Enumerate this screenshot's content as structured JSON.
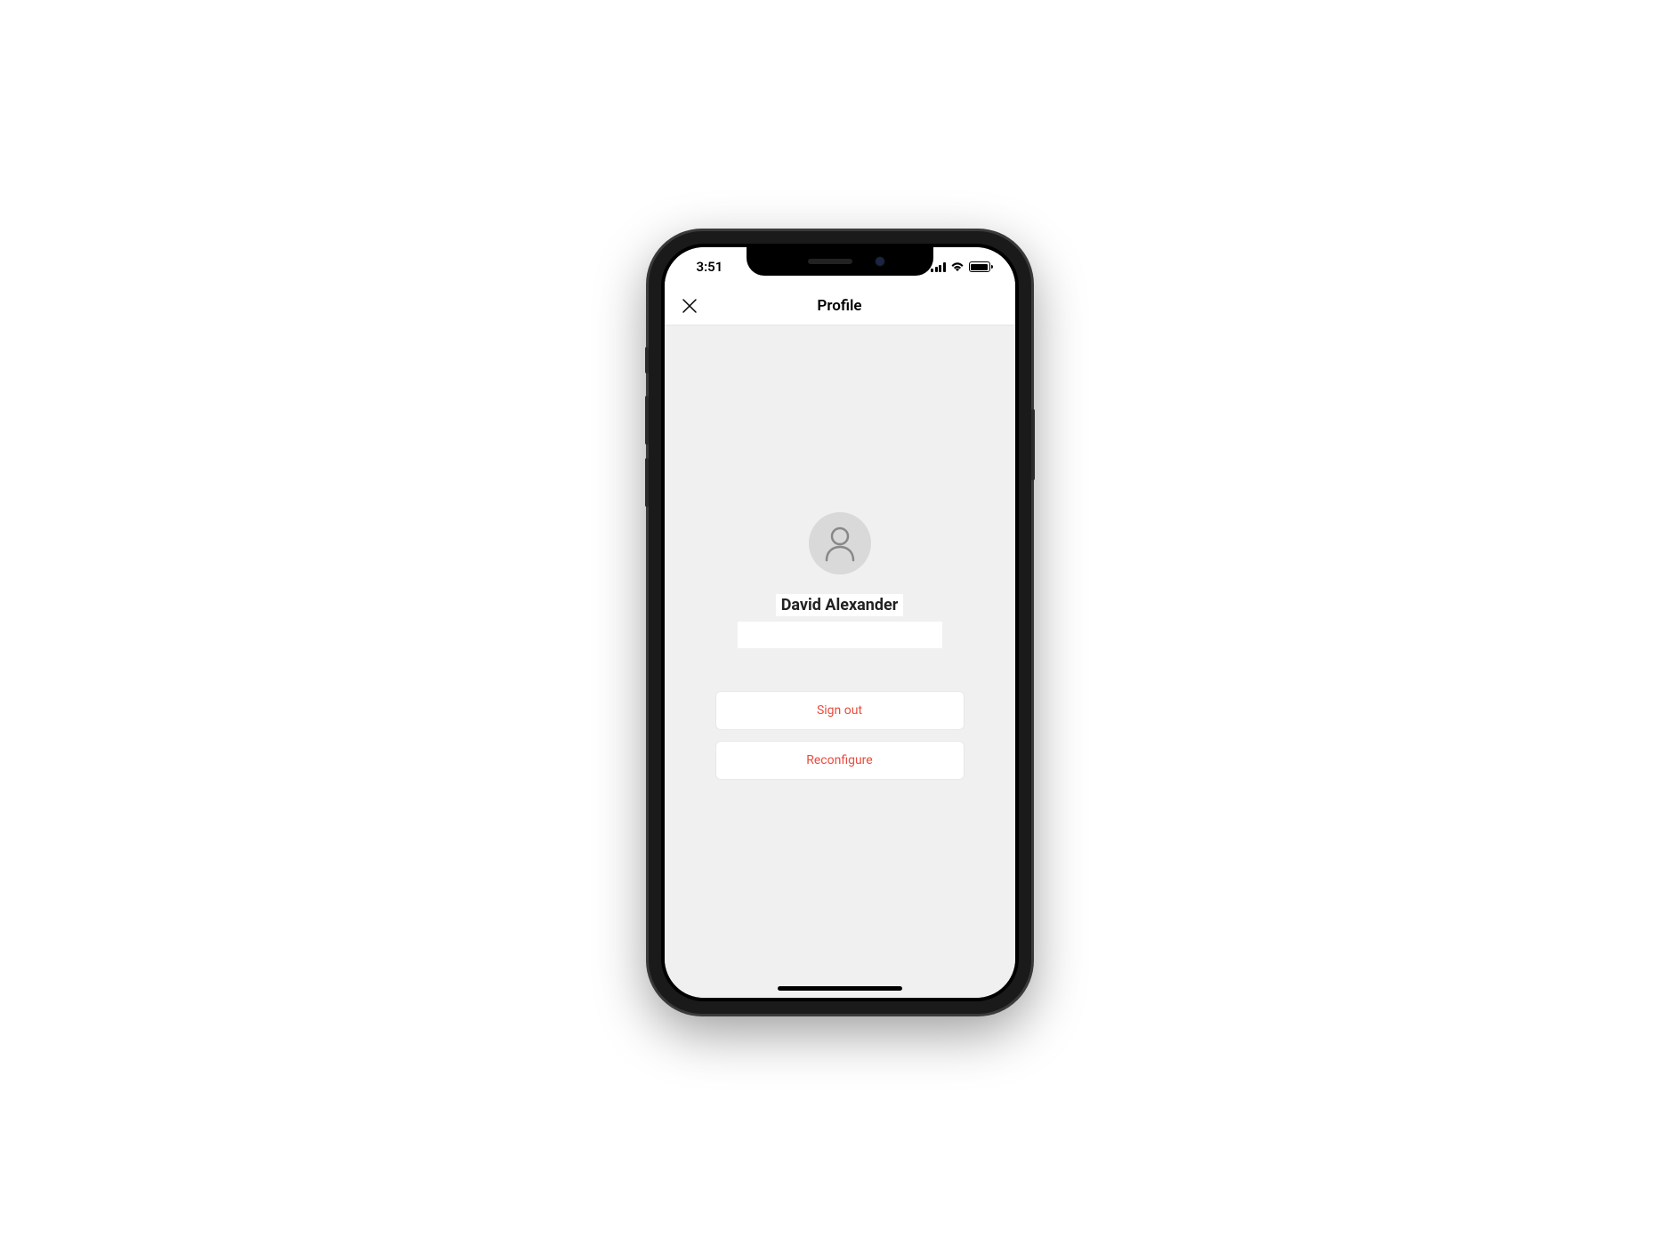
{
  "status_bar": {
    "time": "3:51"
  },
  "nav": {
    "title": "Profile"
  },
  "profile": {
    "name": "David Alexander"
  },
  "actions": {
    "sign_out": "Sign out",
    "reconfigure": "Reconfigure"
  }
}
